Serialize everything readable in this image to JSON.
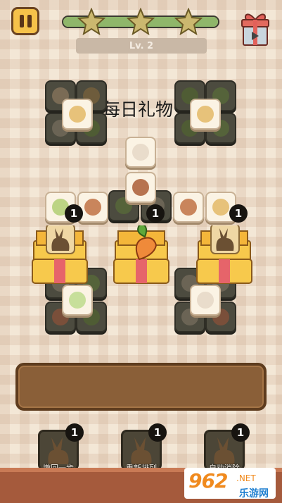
{
  "hud": {
    "level_label": "Lv. 2",
    "stars_earned": 3,
    "stars_total": 3,
    "progress_fraction": 1.0
  },
  "title": "每日礼物",
  "gift_boxes": [
    {
      "count": "1",
      "content_icon": "rabbit-silhouette-icon"
    },
    {
      "count": "1",
      "content_icon": "carrot-icon"
    },
    {
      "count": "1",
      "content_icon": "rabbit-silhouette-icon"
    }
  ],
  "powerups": [
    {
      "label": "撤回一步",
      "count": "1",
      "icon": "undo-rabbit-icon"
    },
    {
      "label": "重新排列",
      "count": "1",
      "icon": "shuffle-rabbit-icon"
    },
    {
      "label": "自动消除",
      "count": "1",
      "icon": "hint-rabbit-icon"
    }
  ],
  "watermark": {
    "logo": "962",
    "tld": ".NET",
    "site": "乐游网"
  },
  "colors": {
    "accent": "#f6c24a",
    "progress": "#8fb66a",
    "tray": "#8a5f38",
    "badge": "#171410"
  }
}
